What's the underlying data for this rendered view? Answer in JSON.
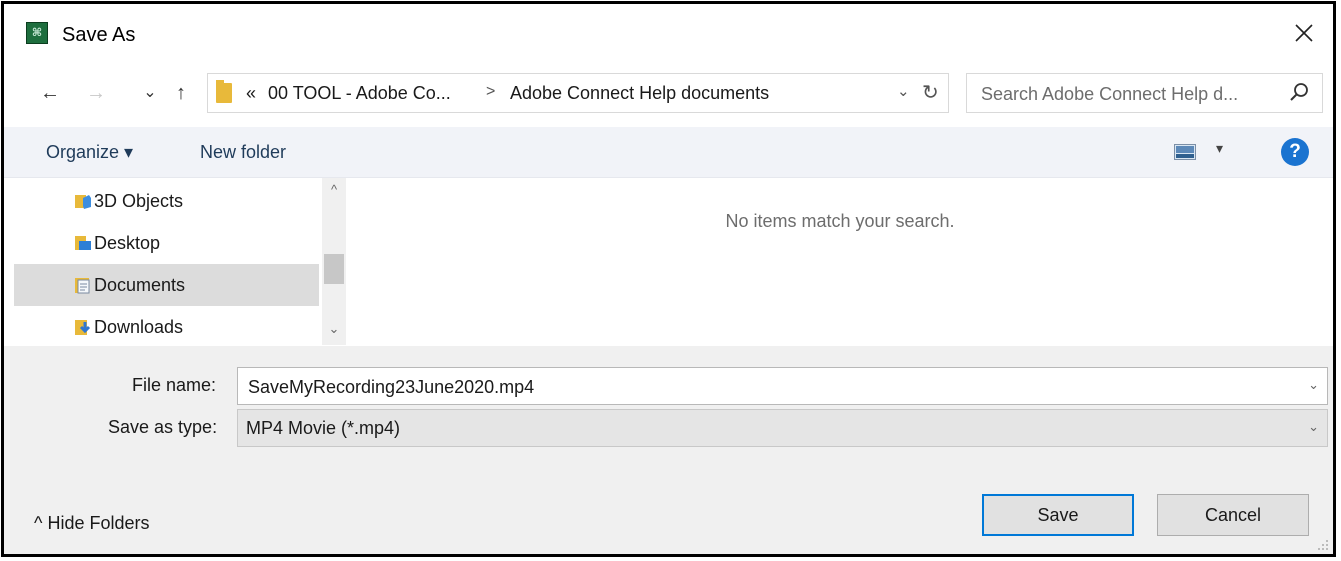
{
  "window": {
    "title": "Save As",
    "app_icon_glyph": "⌘"
  },
  "nav": {
    "back_icon": "←",
    "forward_icon": "→",
    "recent_icon": "⌄",
    "up_icon": "↑",
    "breadcrumb": {
      "overflow": "«",
      "parts": [
        "00 TOOL - Adobe Co...",
        "Adobe Connect Help documents"
      ],
      "separator": ">"
    },
    "dropdown_icon": "⌄",
    "refresh_icon": "↻",
    "search_placeholder": "Search Adobe Connect Help d..."
  },
  "toolbar": {
    "organize_label": "Organize ▾",
    "new_folder_label": "New folder",
    "help_glyph": "?"
  },
  "sidebar": {
    "items": [
      {
        "label": "3D Objects",
        "icon": "3d-objects-icon",
        "color": "#3d8ee0"
      },
      {
        "label": "Desktop",
        "icon": "desktop-icon",
        "color": "#2d7fd6"
      },
      {
        "label": "Documents",
        "icon": "documents-icon",
        "color": "#7a8aa0",
        "selected": true
      },
      {
        "label": "Downloads",
        "icon": "downloads-icon",
        "color": "#2f76d2"
      }
    ]
  },
  "content": {
    "empty_message": "No items match your search."
  },
  "form": {
    "file_name_label": "File name:",
    "file_name_value": "SaveMyRecording23June2020.mp4",
    "save_type_label": "Save as type:",
    "save_type_value": "MP4 Movie (*.mp4)",
    "dropdown_glyph": "⌄"
  },
  "footer": {
    "hide_folders_label": "^ Hide Folders",
    "save_label": "Save",
    "cancel_label": "Cancel"
  },
  "colors": {
    "accent": "#0078d7",
    "help": "#1a73d0",
    "folder": "#e8b93a"
  }
}
